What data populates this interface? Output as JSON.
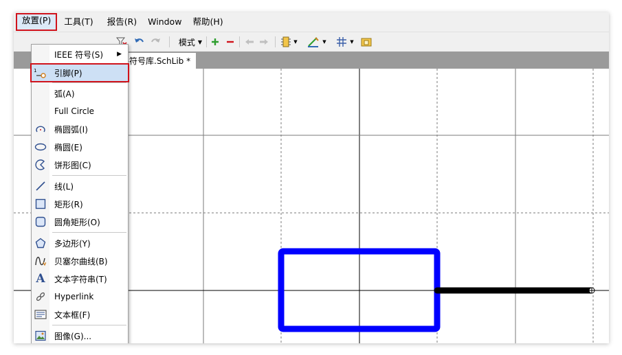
{
  "menubar": {
    "items": [
      "放置(P)",
      "工具(T)",
      "报告(R)",
      "Window",
      "帮助(H)"
    ]
  },
  "toolbar": {
    "mode_label": "模式"
  },
  "document_tab": {
    "label": "元件符号库.SchLib *"
  },
  "place_menu": {
    "items": [
      {
        "label": "IEEE 符号(S)",
        "icon": "none",
        "submenu": true
      },
      {
        "label": "引脚(P)",
        "icon": "pin-icon",
        "highlighted": true
      },
      {
        "label": "弧(A)",
        "icon": "none"
      },
      {
        "label": "Full Circle",
        "icon": "none"
      },
      {
        "label": "椭圆弧(I)",
        "icon": "elliptical-arc-icon"
      },
      {
        "label": "椭圆(E)",
        "icon": "ellipse-icon"
      },
      {
        "label": "饼形图(C)",
        "icon": "pie-icon"
      },
      {
        "label": "线(L)",
        "icon": "line-icon"
      },
      {
        "label": "矩形(R)",
        "icon": "rectangle-icon"
      },
      {
        "label": "圆角矩形(O)",
        "icon": "round-rectangle-icon"
      },
      {
        "label": "多边形(Y)",
        "icon": "polygon-icon"
      },
      {
        "label": "贝塞尔曲线(B)",
        "icon": "bezier-icon"
      },
      {
        "label": "文本字符串(T)",
        "icon": "text-string-icon"
      },
      {
        "label": "Hyperlink",
        "icon": "hyperlink-icon"
      },
      {
        "label": "文本框(F)",
        "icon": "text-frame-icon"
      },
      {
        "label": "图像(G)...",
        "icon": "image-icon"
      }
    ]
  },
  "colors": {
    "rectangle": "#0000ff",
    "pin": "#000000",
    "highlight_border": "#d0121b",
    "highlight_fill": "#cde0f5"
  }
}
